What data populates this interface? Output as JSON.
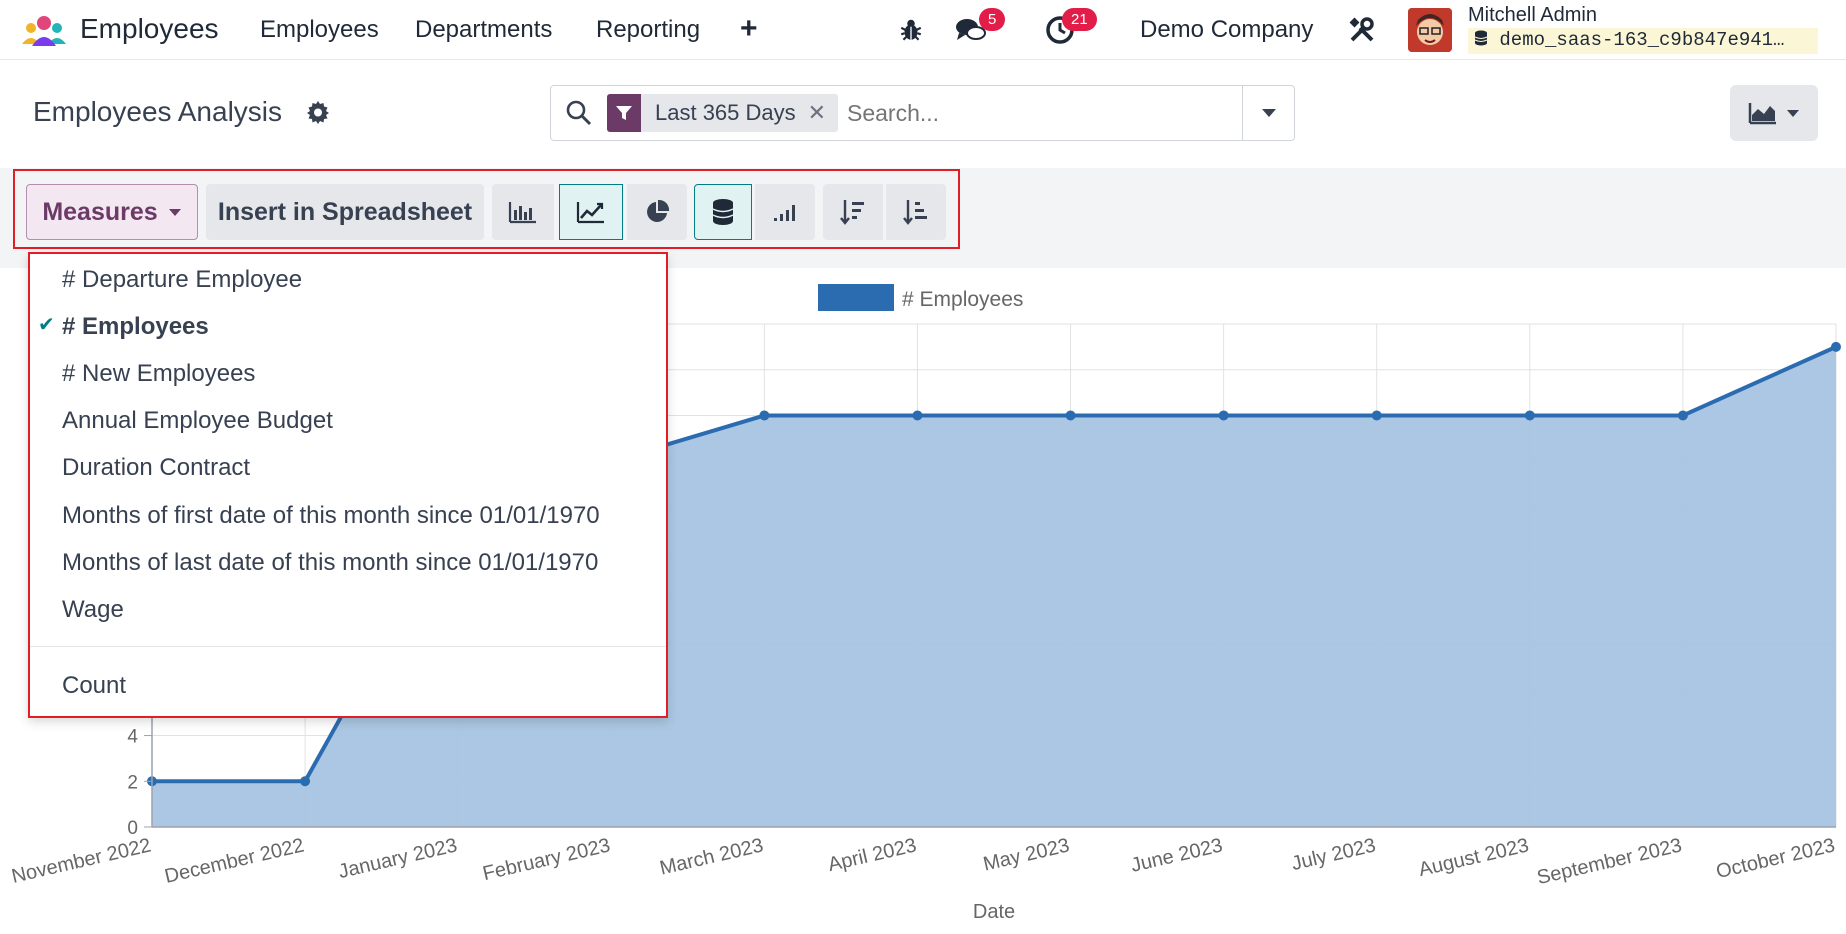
{
  "navbar": {
    "app_name": "Employees",
    "menus": [
      "Employees",
      "Departments",
      "Reporting"
    ],
    "messages_badge": "5",
    "activity_badge": "21",
    "company": "Demo Company",
    "user_name": "Mitchell Admin",
    "database": "demo_saas-163_c9b847e941…"
  },
  "control_panel": {
    "title": "Employees Analysis",
    "search": {
      "facet_label": "Last 365 Days",
      "placeholder": "Search..."
    }
  },
  "toolbar": {
    "measures_label": "Measures",
    "spreadsheet_label": "Insert in Spreadsheet"
  },
  "measures_menu": {
    "items": [
      {
        "label": "# Departure Employee",
        "selected": false
      },
      {
        "label": "# Employees",
        "selected": true
      },
      {
        "label": "# New Employees",
        "selected": false
      },
      {
        "label": "Annual Employee Budget",
        "selected": false
      },
      {
        "label": "Duration Contract",
        "selected": false
      },
      {
        "label": "Months of first date of this month since 01/01/1970",
        "selected": false
      },
      {
        "label": "Months of last date of this month since 01/01/1970",
        "selected": false
      },
      {
        "label": "Wage",
        "selected": false
      }
    ],
    "count_label": "Count"
  },
  "colors": {
    "brand": "#6b3a66",
    "active_teal": "#017e84",
    "series_line": "#2b6cb0",
    "series_fill": "#a8c4e2",
    "highlight_border": "#e11d26",
    "badge": "#e11d48"
  },
  "chart_data": {
    "type": "area",
    "title": "",
    "xlabel": "Date",
    "ylabel": "",
    "legend": "top-center",
    "grid": true,
    "categories": [
      "November 2022",
      "December 2022",
      "January 2023",
      "February 2023",
      "March 2023",
      "April 2023",
      "May 2023",
      "June 2023",
      "July 2023",
      "August 2023",
      "September 2023",
      "October 2023"
    ],
    "series": [
      {
        "name": "# Employees",
        "values": [
          2,
          2,
          14,
          16,
          18,
          18,
          18,
          18,
          18,
          18,
          18,
          21
        ]
      }
    ],
    "ylim": [
      0,
      22
    ],
    "yticks": [
      0,
      2,
      4
    ]
  }
}
